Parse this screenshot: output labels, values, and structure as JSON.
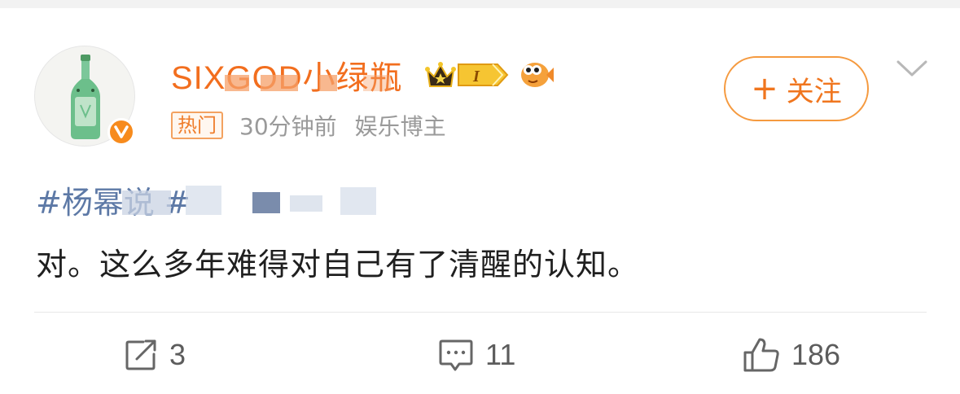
{
  "post": {
    "author": {
      "name": "SIXGOD小绿瓶",
      "level_badge": "I",
      "follow_label": "关注",
      "follow_plus": "+"
    },
    "meta": {
      "hot_tag": "热门",
      "time": "30分钟前",
      "role": "娱乐博主"
    },
    "hashtag": "#杨幂说       #",
    "content": "对。这么多年难得对自己有了清醒的认知。",
    "actions": {
      "share_count": "3",
      "comment_count": "11",
      "like_count": "186"
    }
  },
  "colors": {
    "accent_orange": "#f26e1e",
    "link_blue": "#5d79a6",
    "meta_gray": "#9a9a9a",
    "avatar_bottle_green": "#6cbf8b"
  },
  "icons": {
    "avatar": "green-bottle-avatar",
    "verified": "verified-v-icon",
    "crown": "crown-icon",
    "fish": "fish-icon",
    "chevron": "chevron-down-icon",
    "share": "share-icon",
    "comment": "comment-icon",
    "like": "thumbs-up-icon"
  }
}
